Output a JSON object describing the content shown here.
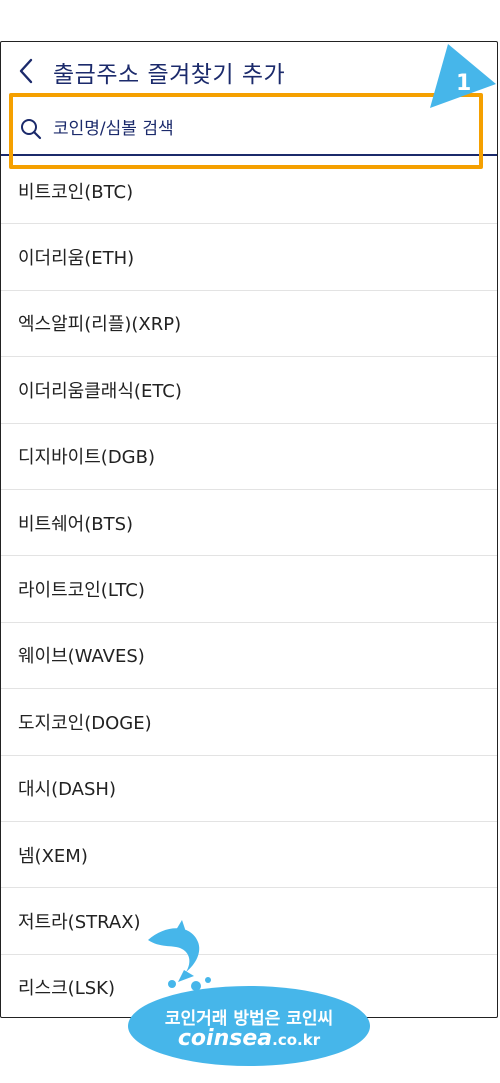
{
  "header": {
    "title": "출금주소 즐겨찾기 추가",
    "back_icon": "chevron-left-icon"
  },
  "search": {
    "placeholder": "코인명/심볼 검색",
    "icon": "search-icon"
  },
  "marker": {
    "label": "1",
    "color": "#46b6ea"
  },
  "highlight_color": "#f5a000",
  "accent_color": "#1b2a6b",
  "coins": [
    "비트코인(BTC)",
    "이더리움(ETH)",
    "엑스알피(리플)(XRP)",
    "이더리움클래식(ETC)",
    "디지바이트(DGB)",
    "비트쉐어(BTS)",
    "라이트코인(LTC)",
    "웨이브(WAVES)",
    "도지코인(DOGE)",
    "대시(DASH)",
    "넴(XEM)",
    "저트라(STRAX)",
    "리스크(LSK)"
  ],
  "watermark": {
    "line1": "코인거래 방법은 코인씨",
    "line2_main": "coinsea",
    "line2_suffix": ".co.kr"
  }
}
